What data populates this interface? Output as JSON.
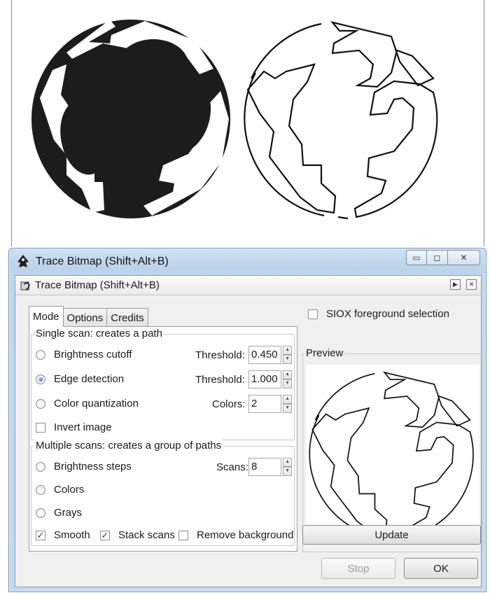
{
  "outer_window": {
    "title": "Trace Bitmap (Shift+Alt+B)",
    "buttons": {
      "minimize": "▭",
      "maximize": "◻",
      "close": "✕"
    }
  },
  "dialog": {
    "title": "Trace Bitmap (Shift+Alt+B)",
    "tabs": [
      {
        "label": "Mode",
        "active": true
      },
      {
        "label": "Options",
        "active": false
      },
      {
        "label": "Credits",
        "active": false
      }
    ],
    "single_scan": {
      "legend": "Single scan: creates a path",
      "brightness_cutoff": {
        "label": "Brightness cutoff",
        "selected": false,
        "field_label": "Threshold:",
        "value": "0.450"
      },
      "edge_detection": {
        "label": "Edge detection",
        "selected": true,
        "field_label": "Threshold:",
        "value": "1.000"
      },
      "color_quantization": {
        "label": "Color quantization",
        "selected": false,
        "field_label": "Colors:",
        "value": "2"
      },
      "invert_image": {
        "label": "Invert image",
        "checked": false
      }
    },
    "multiple_scans": {
      "legend": "Multiple scans: creates a group of paths",
      "brightness_steps": {
        "label": "Brightness steps",
        "selected": false,
        "field_label": "Scans:",
        "value": "8"
      },
      "colors": {
        "label": "Colors",
        "selected": false
      },
      "grays": {
        "label": "Grays",
        "selected": false
      },
      "smooth": {
        "label": "Smooth",
        "checked": true
      },
      "stack_scans": {
        "label": "Stack scans",
        "checked": true
      },
      "remove_background": {
        "label": "Remove background",
        "checked": false
      }
    },
    "siox": {
      "label": "SIOX foreground selection",
      "checked": false
    },
    "preview": {
      "legend": "Preview",
      "update_label": "Update"
    },
    "stop_label": "Stop",
    "ok_label": "OK"
  },
  "colors": {
    "accent": "#1d5ea8",
    "titlebar": "#c3d6ec",
    "dialog_bg": "#f0f0f0"
  }
}
